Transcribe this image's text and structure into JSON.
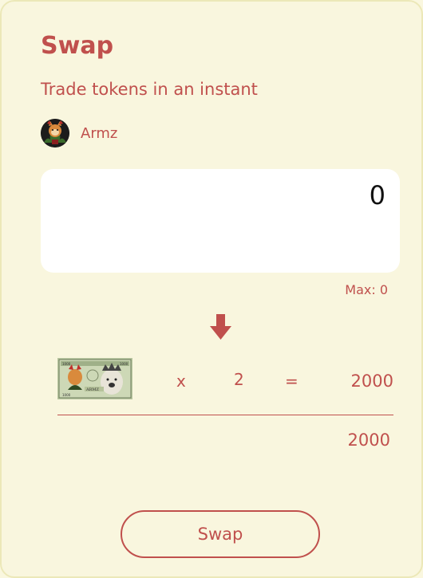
{
  "header": {
    "title": "Swap",
    "subtitle": "Trade tokens in an instant"
  },
  "account": {
    "name": "Armz",
    "avatar_icon": "armz-avatar"
  },
  "input": {
    "value": "0",
    "max_label": "Max: 0"
  },
  "conversion": {
    "token_image": "armz-banknote-image",
    "multiply_sign": "x",
    "multiplier": "2",
    "equals_sign": "=",
    "result": "2000",
    "total": "2000"
  },
  "actions": {
    "swap_label": "Swap"
  },
  "colors": {
    "accent": "#c0504d",
    "background": "#f9f6de",
    "border": "#ece8b8",
    "input_bg": "#ffffff"
  }
}
